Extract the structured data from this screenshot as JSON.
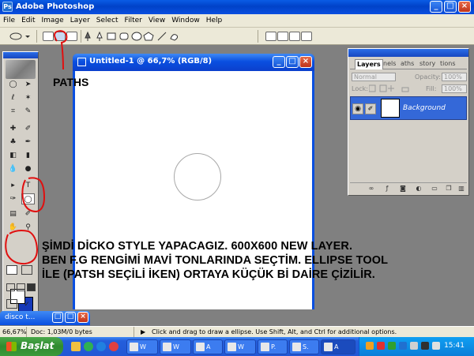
{
  "app": {
    "title": "Adobe Photoshop",
    "logo_text": "Ps"
  },
  "menu": [
    "File",
    "Edit",
    "Image",
    "Layer",
    "Select",
    "Filter",
    "View",
    "Window",
    "Help"
  ],
  "window_controls": {
    "minimize": "_",
    "maximize": "□",
    "close": "×"
  },
  "document": {
    "title": "Untitled-1 @ 66,7% (RGB/8)"
  },
  "layers_panel": {
    "tabs": [
      "Layers",
      "nels",
      "aths",
      "story",
      "tions"
    ],
    "blend_mode": "Normal",
    "opacity_label": "Opacity:",
    "opacity_value": "100%",
    "lock_label": "Lock:",
    "fill_label": "Fill:",
    "fill_value": "100%",
    "layer_name": "Background"
  },
  "minimized_doc": {
    "title": "disco t..."
  },
  "status_bar": {
    "zoom": "66,67%",
    "doc_size": "Doc: 1,03M/0 bytes",
    "hint": "Click and drag to draw a ellipse.  Use Shift, Alt, and Ctrl for additional options."
  },
  "taskbar": {
    "start_label": "Başlat",
    "tasks": [
      "W",
      "W",
      "A",
      "W",
      "P.",
      "S.",
      "A"
    ],
    "clock": "15:41"
  },
  "annotations": {
    "paths_label": "PATHS",
    "lines": [
      "ŞİMDİ DİCKO STYLE YAPACAGIZ. 600X600 NEW LAYER.",
      "BEN F.G RENGİMİ MAVİ TONLARINDA SEÇTİM. ELLIPSE TOOL",
      "İLE (PATSH SEÇİLİ İKEN) ORTAYA KÜÇÜK Bİ DAİRE ÇİZİLİR."
    ]
  },
  "colors": {
    "foreground": "#ffffff",
    "background": "#1538b8",
    "annotation_red": "#e01010",
    "workspace": "#808080"
  }
}
